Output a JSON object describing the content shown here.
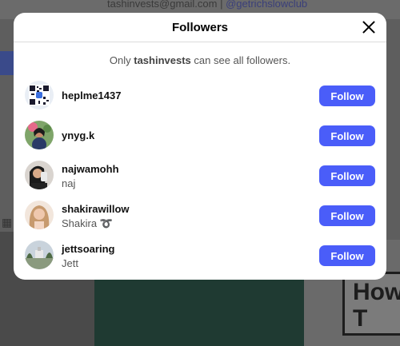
{
  "background": {
    "email_text": "tashinvests@gmail.com | ",
    "email_link": "@getrichslowclub",
    "poster_text": "How T"
  },
  "modal": {
    "title": "Followers",
    "notice_prefix": "Only ",
    "notice_user": "tashinvests",
    "notice_suffix": " can see all followers."
  },
  "followers": [
    {
      "username": "heplme1437",
      "display_name": "",
      "button": "Follow"
    },
    {
      "username": "ynyg.k",
      "display_name": "",
      "button": "Follow"
    },
    {
      "username": "najwamohh",
      "display_name": "naj",
      "button": "Follow"
    },
    {
      "username": "shakirawillow",
      "display_name": "Shakira ➰",
      "button": "Follow"
    },
    {
      "username": "jettsoaring",
      "display_name": "Jett",
      "button": "Follow"
    }
  ],
  "colors": {
    "follow_button": "#4a5df9",
    "overlay": "#5e5e5e"
  }
}
